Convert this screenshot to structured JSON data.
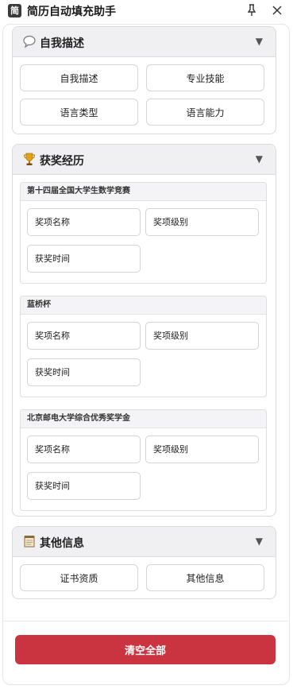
{
  "app": {
    "icon_char": "简",
    "title": "简历自动填充助手",
    "pin_icon": "pin-icon",
    "close_icon": "close-icon"
  },
  "sections": {
    "self": {
      "title": "自我描述",
      "icon": "speech-bubble-icon",
      "buttons": [
        "自我描述",
        "专业技能",
        "语言类型",
        "语言能力"
      ]
    },
    "awards": {
      "title": "获奖经历",
      "icon": "trophy-icon",
      "entries": [
        {
          "name": "第十四届全国大学生数学竞赛",
          "fields": [
            "奖项名称",
            "奖项级别",
            "获奖时间"
          ]
        },
        {
          "name": "蓝桥杯",
          "fields": [
            "奖项名称",
            "奖项级别",
            "获奖时间"
          ]
        },
        {
          "name": "北京邮电大学综合优秀奖学金",
          "fields": [
            "奖项名称",
            "奖项级别",
            "获奖时间"
          ]
        }
      ]
    },
    "other": {
      "title": "其他信息",
      "icon": "notepad-icon",
      "buttons": [
        "证书资质",
        "其他信息"
      ]
    }
  },
  "caret_char": "▼",
  "clear_label": "清空全部",
  "colors": {
    "danger": "#c93440",
    "header_bg": "#f0f0f2"
  }
}
